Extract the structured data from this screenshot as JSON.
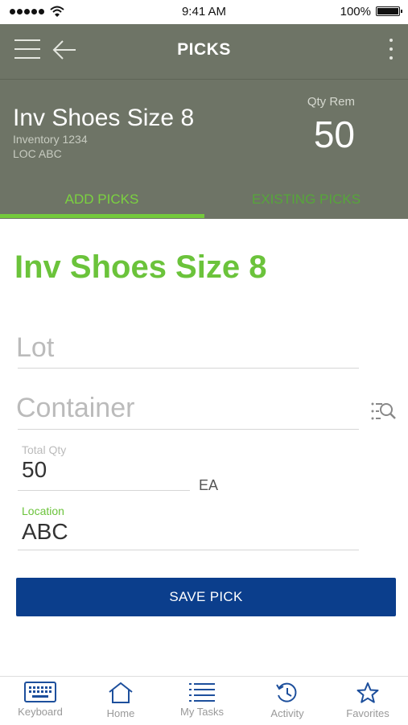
{
  "status_bar": {
    "time": "9:41 AM",
    "battery": "100%"
  },
  "header": {
    "title": "PICKS",
    "item_name": "Inv Shoes Size 8",
    "inventory": "Inventory 1234",
    "location_code": "LOC ABC",
    "qty_label": "Qty Rem",
    "qty_value": "50"
  },
  "tabs": [
    {
      "label": "ADD PICKS",
      "active": true
    },
    {
      "label": "EXISTING PICKS",
      "active": false
    }
  ],
  "form": {
    "heading": "Inv Shoes Size 8",
    "lot_placeholder": "Lot",
    "container_placeholder": "Container",
    "total_qty_label": "Total Qty",
    "total_qty_value": "50",
    "unit": "EA",
    "location_label": "Location",
    "location_value": "ABC",
    "save_label": "SAVE PICK"
  },
  "colors": {
    "header_bg": "#6e7466",
    "accent_green": "#6bc33b",
    "save_button": "#0b3e8c",
    "nav_icon": "#1d4f9c"
  },
  "bottom_nav": [
    {
      "label": "Keyboard",
      "icon": "keyboard-icon"
    },
    {
      "label": "Home",
      "icon": "home-icon"
    },
    {
      "label": "My Tasks",
      "icon": "tasks-icon"
    },
    {
      "label": "Activity",
      "icon": "activity-icon"
    },
    {
      "label": "Favorites",
      "icon": "star-icon"
    }
  ]
}
